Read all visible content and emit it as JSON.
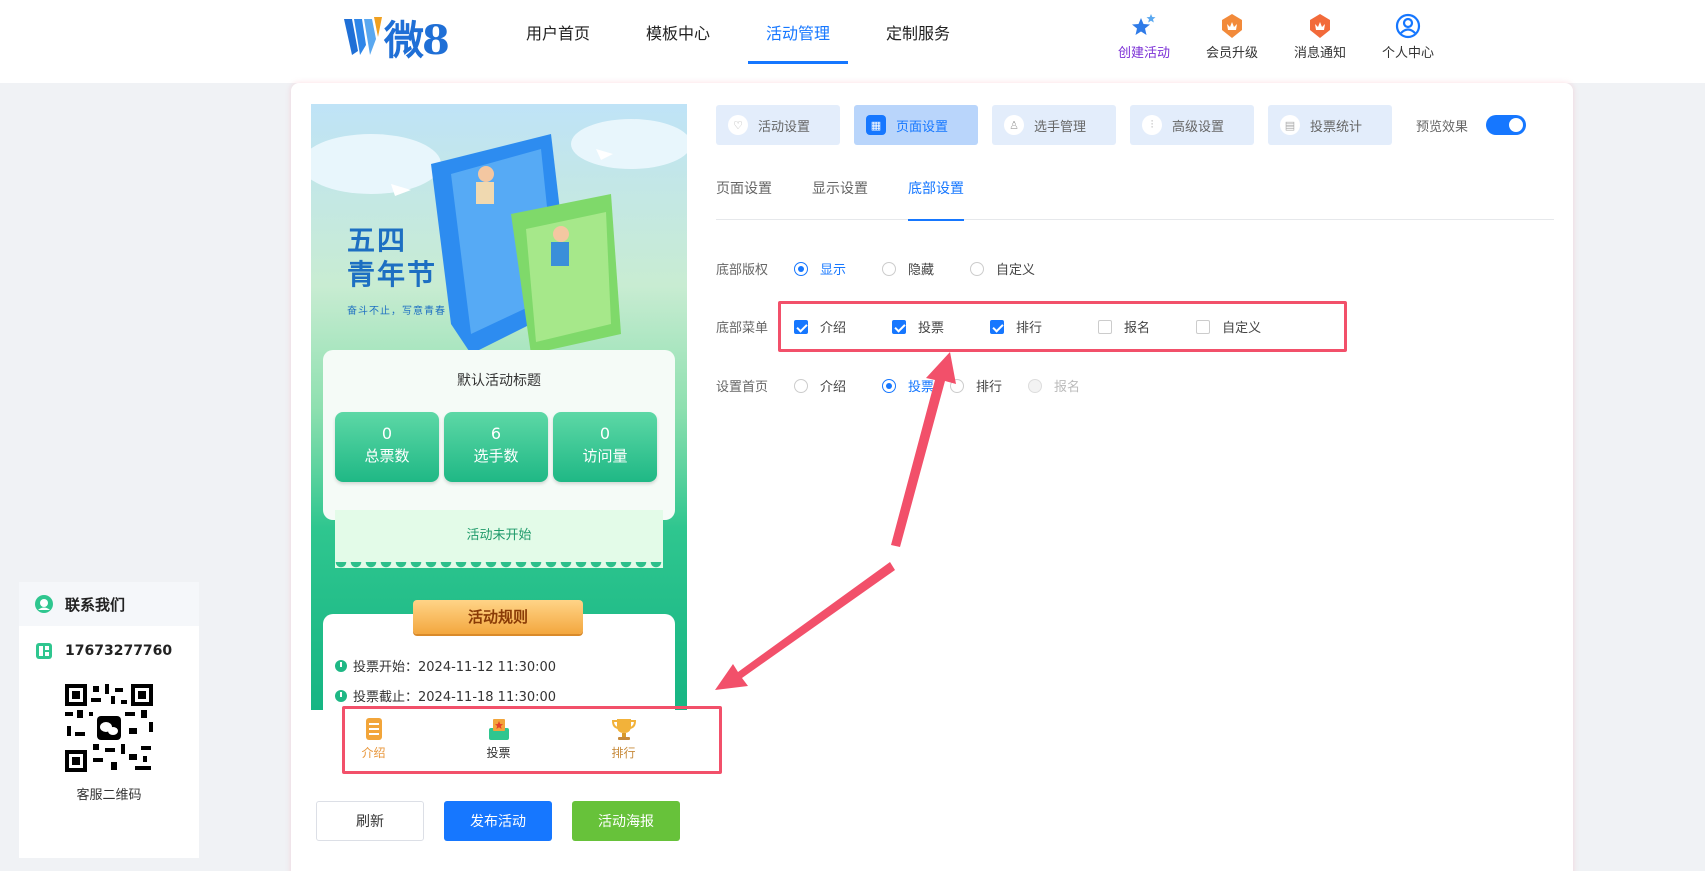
{
  "logo": {
    "text": "微8"
  },
  "nav": [
    {
      "label": "用户首页"
    },
    {
      "label": "模板中心"
    },
    {
      "label": "活动管理",
      "active": true
    },
    {
      "label": "定制服务"
    }
  ],
  "tools": [
    {
      "label": "创建活动",
      "icon": "star-create-icon"
    },
    {
      "label": "会员升级",
      "icon": "vip-badge-icon"
    },
    {
      "label": "消息通知",
      "icon": "message-badge-icon"
    },
    {
      "label": "个人中心",
      "icon": "user-circle-icon"
    }
  ],
  "preview": {
    "banner_title_1": "五四",
    "banner_title_2": "青年节",
    "banner_sub": "奋斗不止，写意青春",
    "activity_title": "默认活动标题",
    "stats": [
      {
        "value": "0",
        "label": "总票数"
      },
      {
        "value": "6",
        "label": "选手数"
      },
      {
        "value": "0",
        "label": "访问量"
      }
    ],
    "status": "活动未开始",
    "rules_title": "活动规则",
    "rules": [
      "投票开始：2024-11-12 11:30:00",
      "投票截止：2024-11-18 11:30:00"
    ],
    "tabbar": [
      {
        "label": "介绍",
        "color": "#e8963a"
      },
      {
        "label": "投票",
        "color": "#333333"
      },
      {
        "label": "排行",
        "color": "#c78a3a"
      }
    ]
  },
  "buttons": {
    "refresh": "刷新",
    "publish": "发布活动",
    "poster": "活动海报"
  },
  "settings": {
    "top_tabs": [
      {
        "label": "活动设置"
      },
      {
        "label": "页面设置",
        "active": true
      },
      {
        "label": "选手管理"
      },
      {
        "label": "高级设置"
      },
      {
        "label": "投票统计"
      }
    ],
    "preview_label": "预览效果",
    "preview_on": true,
    "sub_tabs": [
      {
        "label": "页面设置"
      },
      {
        "label": "显示设置"
      },
      {
        "label": "底部设置",
        "active": true
      }
    ],
    "copyright": {
      "label": "底部版权",
      "options": [
        "显示",
        "隐藏",
        "自定义"
      ],
      "selected": "显示"
    },
    "menu": {
      "label": "底部菜单",
      "options": [
        {
          "label": "介绍",
          "checked": true
        },
        {
          "label": "投票",
          "checked": true
        },
        {
          "label": "排行",
          "checked": true
        },
        {
          "label": "报名",
          "checked": false
        },
        {
          "label": "自定义",
          "checked": false
        }
      ]
    },
    "home": {
      "label": "设置首页",
      "options": [
        "介绍",
        "投票",
        "排行",
        "报名"
      ],
      "selected": "投票",
      "disabled": "报名"
    }
  },
  "contact": {
    "title": "联系我们",
    "phone": "17673277760",
    "qr_label": "客服二维码"
  },
  "colors": {
    "accent": "#1677ff",
    "highlight": "#f2506a",
    "green": "#67c23a"
  }
}
